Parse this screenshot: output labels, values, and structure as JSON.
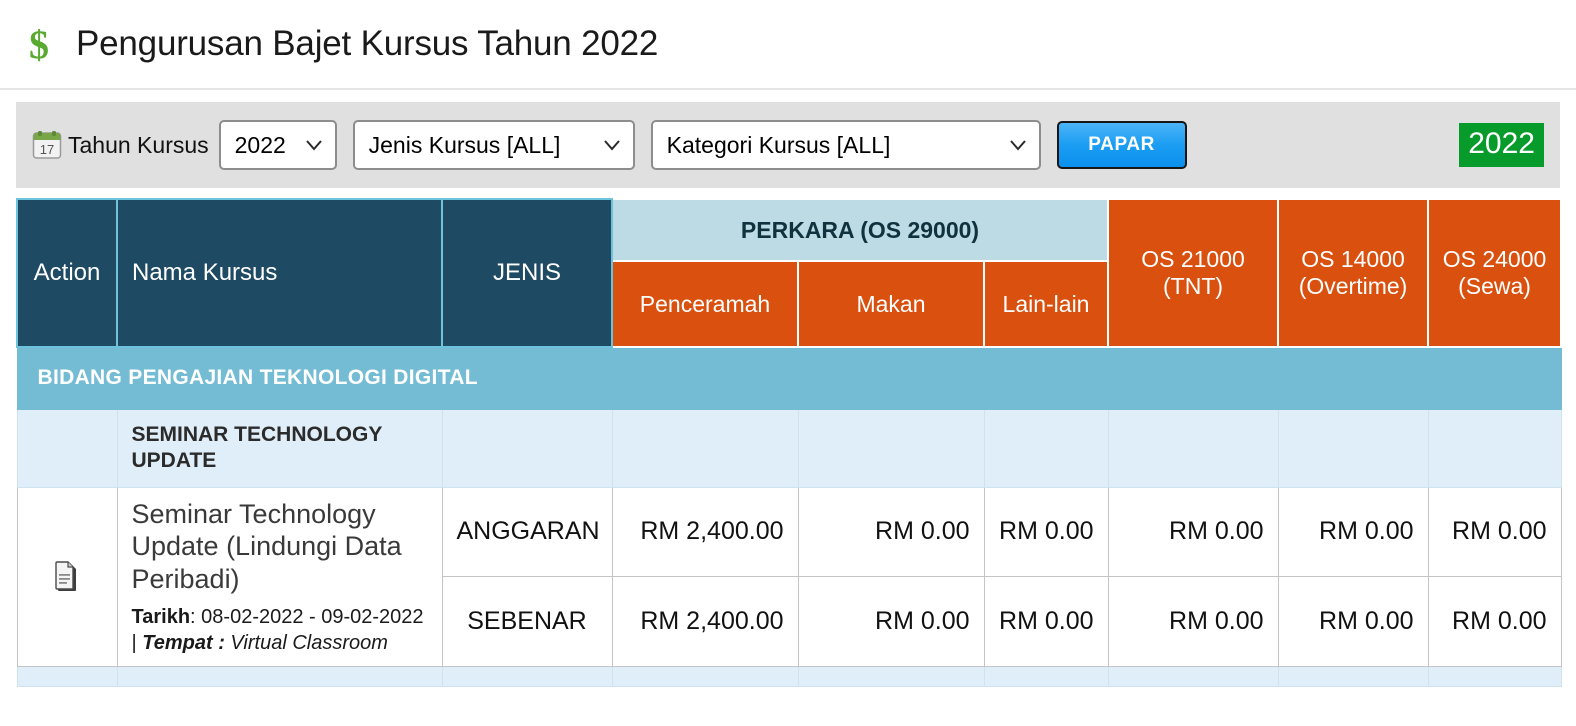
{
  "header": {
    "icon": "dollar-icon",
    "title": "Pengurusan Bajet Kursus Tahun 2022"
  },
  "toolbar": {
    "calendar_icon": "calendar-icon",
    "calendar_day": "17",
    "label": "Tahun Kursus",
    "year_select": {
      "value": "2022"
    },
    "jenis_select": {
      "value": "Jenis Kursus [ALL]"
    },
    "kategori_select": {
      "value": "Kategori Kursus [ALL]"
    },
    "papar_button": "PAPAR",
    "year_badge": "2022"
  },
  "table": {
    "headers": {
      "action": "Action",
      "nama_kursus": "Nama Kursus",
      "jenis": "JENIS",
      "perkara_group": "PERKARA (OS 29000)",
      "penceramah": "Penceramah",
      "makan": "Makan",
      "lain_lain": "Lain-lain",
      "os21000": "OS 21000 (TNT)",
      "os14000": "OS 14000 (Overtime)",
      "os24000": "OS 24000 (Sewa)"
    },
    "bidang": "BIDANG PENGAJIAN TEKNOLOGI DIGITAL",
    "section": "SEMINAR TECHNOLOGY UPDATE",
    "course": {
      "name": "Seminar Technology Update (Lindungi Data Peribadi)",
      "tarikh_label": "Tarikh",
      "tarikh_value": ": 08-02-2022 - 09-02-2022 | ",
      "tempat_label": "Tempat :",
      "tempat_value": " Virtual Classroom",
      "action_icon": "document-icon"
    },
    "rows": [
      {
        "jenis": "ANGGARAN",
        "penceramah": "RM 2,400.00",
        "makan": "RM 0.00",
        "lain_lain": "RM 0.00",
        "os21000": "RM 0.00",
        "os14000": "RM 0.00",
        "os24000": "RM 0.00"
      },
      {
        "jenis": "SEBENAR",
        "penceramah": "RM 2,400.00",
        "makan": "RM 0.00",
        "lain_lain": "RM 0.00",
        "os21000": "RM 0.00",
        "os14000": "RM 0.00",
        "os24000": "RM 0.00"
      }
    ]
  },
  "colors": {
    "navy": "#1f4a63",
    "orange": "#d9500f",
    "light_blue": "#74bcd4",
    "perkara_blue": "#bcdbe4",
    "section_blue": "#dfeef8",
    "green_badge": "#079b2c",
    "papar_blue": "#1a9df2"
  }
}
